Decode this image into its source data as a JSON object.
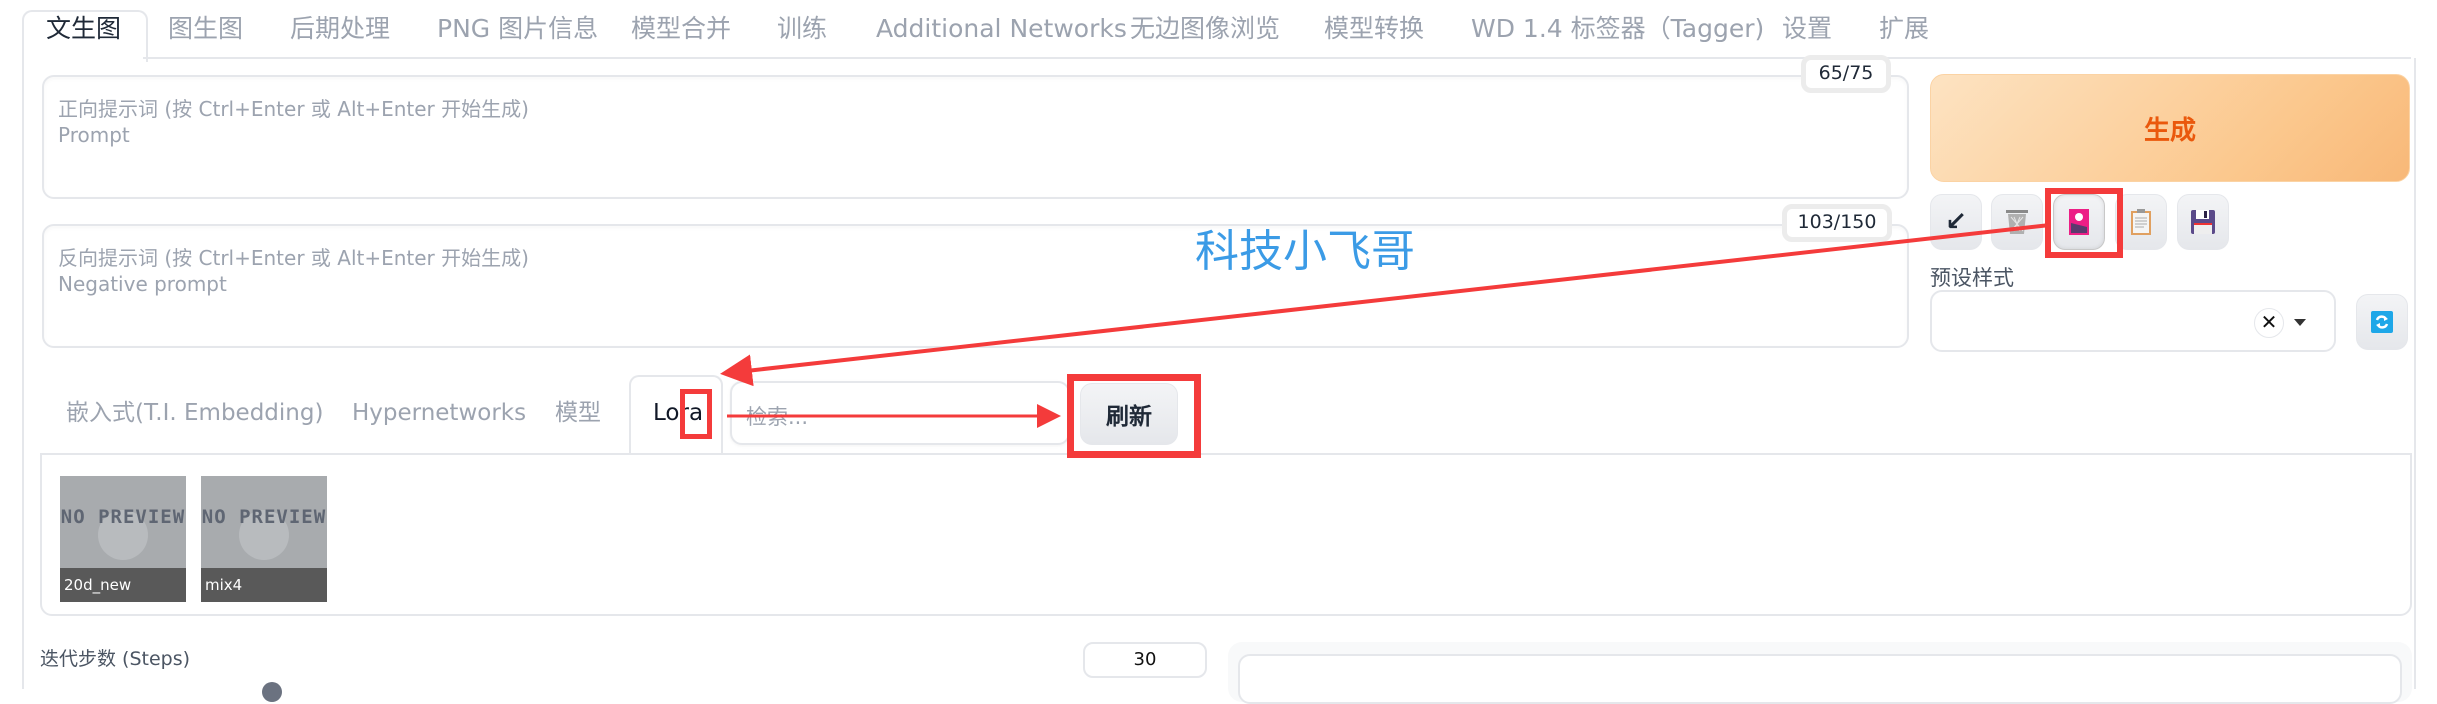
{
  "top_tabs": [
    {
      "label": "文生图",
      "active": true
    },
    {
      "label": "图生图"
    },
    {
      "label": "后期处理"
    },
    {
      "label": "PNG 图片信息"
    },
    {
      "label": "模型合并"
    },
    {
      "label": "训练"
    },
    {
      "label": "Additional Networks"
    },
    {
      "label": "无边图像浏览"
    },
    {
      "label": "模型转换"
    },
    {
      "label": "WD 1.4 标签器（Tagger)"
    },
    {
      "label": "设置"
    },
    {
      "label": "扩展"
    }
  ],
  "prompt": {
    "placeholder_line1": "正向提示词 (按 Ctrl+Enter 或 Alt+Enter 开始生成)",
    "placeholder_line2": "Prompt",
    "token_counter": "65/75"
  },
  "negative_prompt": {
    "placeholder_line1": "反向提示词 (按 Ctrl+Enter 或 Alt+Enter 开始生成)",
    "placeholder_line2": "Negative prompt",
    "token_counter": "103/150"
  },
  "generate_button": {
    "label": "生成"
  },
  "tool_buttons": [
    {
      "icon": "arrow-down-left-icon",
      "glyph": "↙"
    },
    {
      "icon": "trash-icon"
    },
    {
      "icon": "show-extra-networks-icon",
      "highlighted": true
    },
    {
      "icon": "clipboard-icon"
    },
    {
      "icon": "save-floppy-icon"
    }
  ],
  "preset_styles": {
    "label": "预设样式",
    "value": "",
    "clear_glyph": "✕"
  },
  "extra_networks": {
    "tabs": [
      {
        "label": "嵌入式(T.I. Embedding)"
      },
      {
        "label": "Hypernetworks"
      },
      {
        "label": "模型"
      },
      {
        "label": "Lora",
        "active": true
      }
    ],
    "search_placeholder": "检索...",
    "refresh_label": "刷新",
    "cards": [
      {
        "name": "20d_new",
        "preview_text": "NO PREVIEW"
      },
      {
        "name": "mix4",
        "preview_text": "NO PREVIEW"
      }
    ]
  },
  "steps": {
    "label": "迭代步数 (Steps)",
    "value": "30"
  },
  "watermark": "科技小飞哥",
  "colors": {
    "accent_orange": "#ea580c",
    "annotation_red": "#f43b3b",
    "watermark_blue": "#3b9be6"
  }
}
